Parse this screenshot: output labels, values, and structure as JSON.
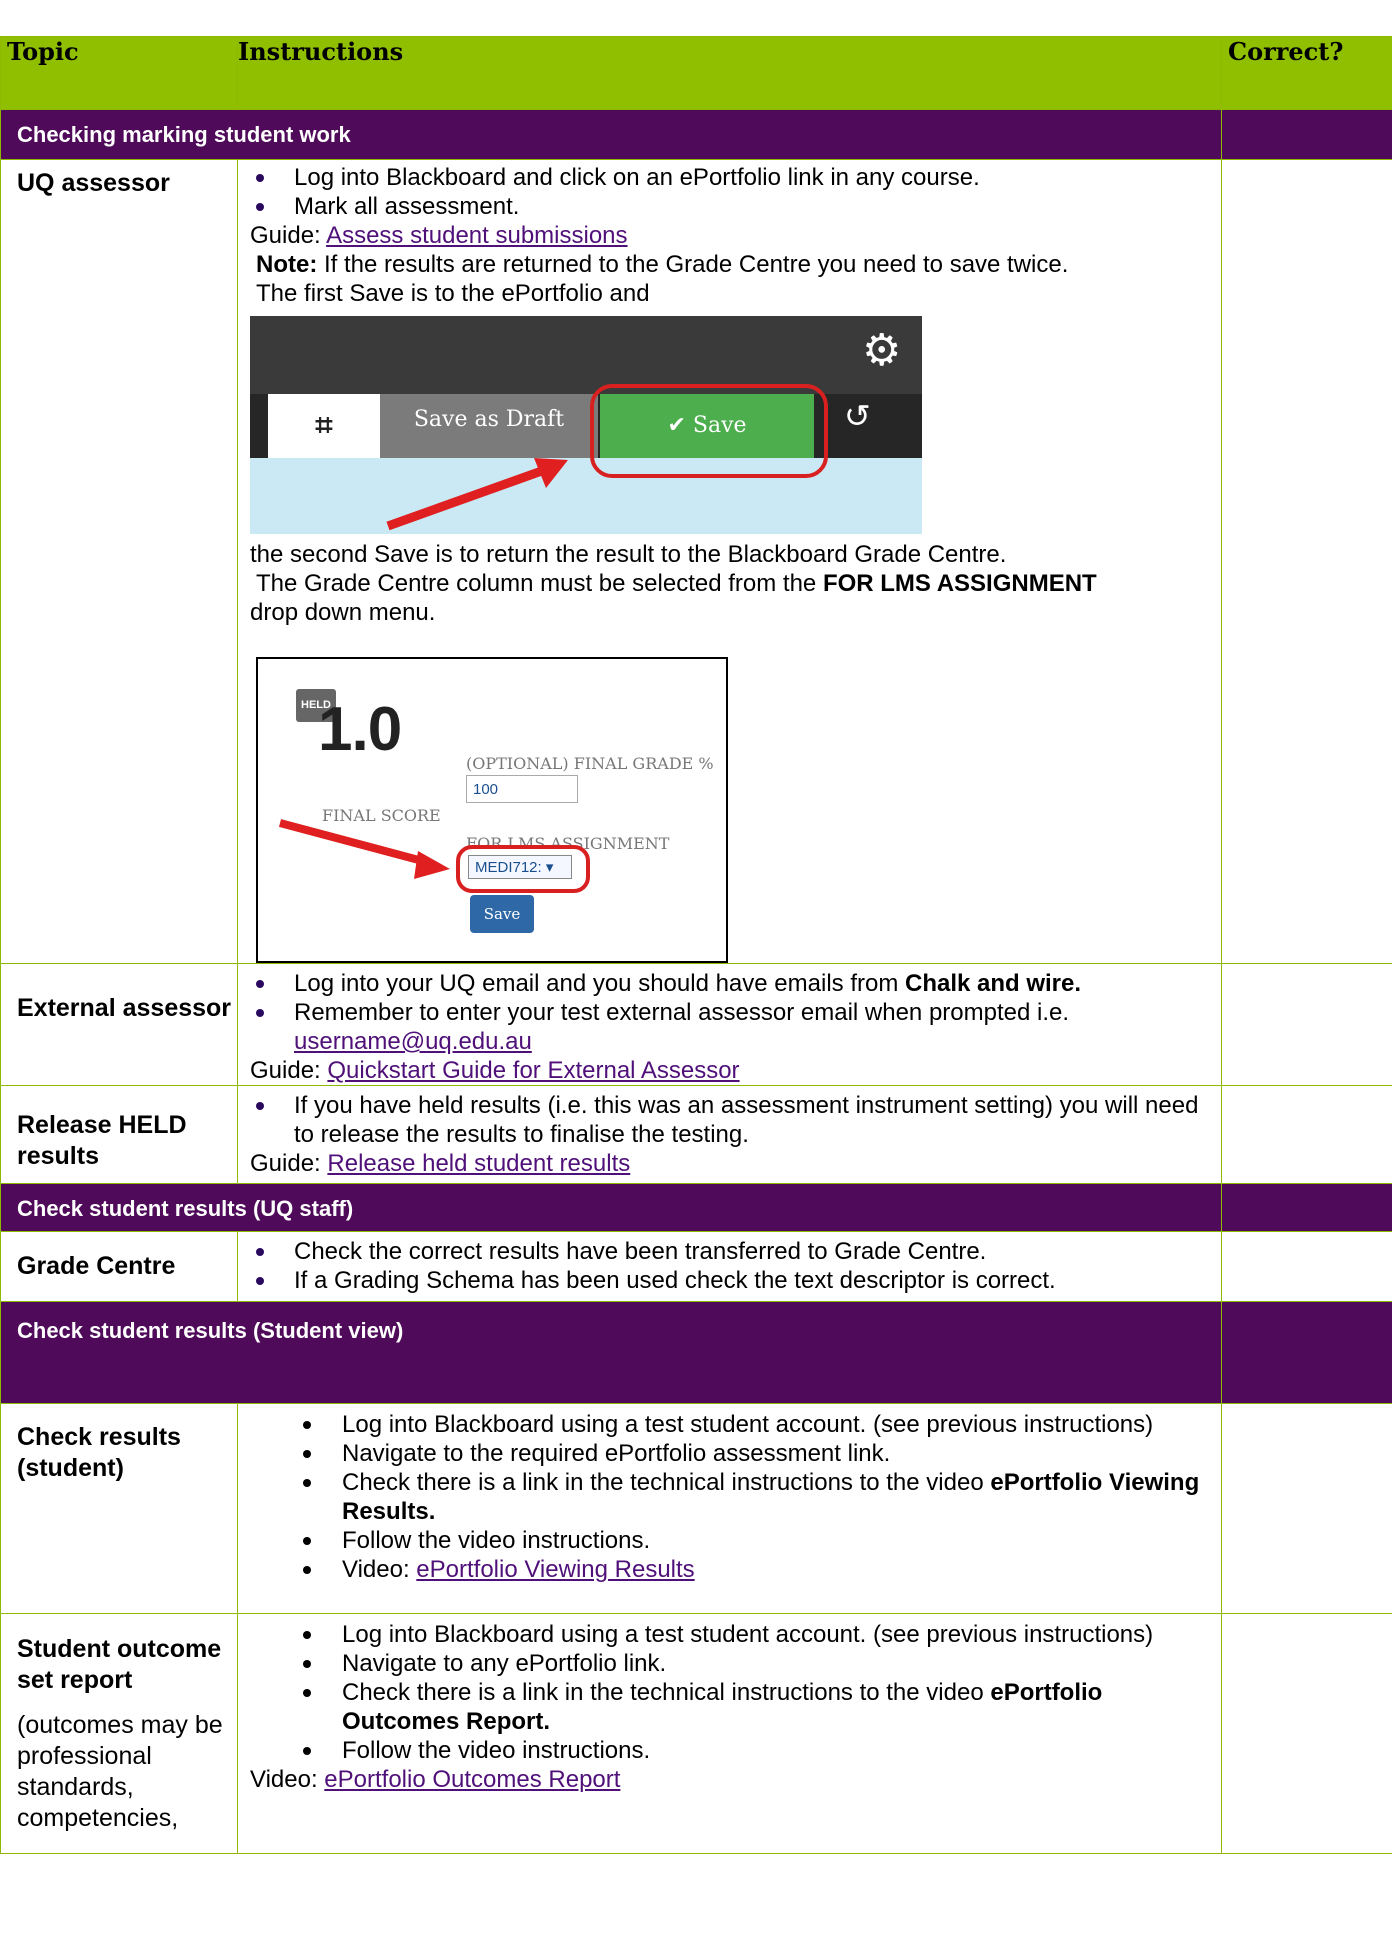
{
  "table": {
    "headers": {
      "topic": "Topic",
      "instructions": "Instructions",
      "correct": "Correct?"
    }
  },
  "sections": {
    "marking": "Checking marking student work",
    "staff": "Check student results (UQ staff)",
    "student": "Check student results (Student view)"
  },
  "rows": {
    "uq_assessor": {
      "topic": "UQ assessor",
      "bullets": [
        "Log into Blackboard and click on an ePortfolio link in any course.",
        "Mark all assessment."
      ],
      "guide_prefix": "Guide: ",
      "guide_link": "Assess student submissions",
      "note_label": "Note:",
      "note_text": " If the results are returned to the Grade Centre you need to save twice.",
      "first_save": "The first Save is to the ePortfolio and",
      "second_save": "the second Save is to return the result to the Blackboard Grade Centre.",
      "grade_col_pre": "The Grade Centre column must be selected from the ",
      "grade_col_bold": "FOR LMS ASSIGNMENT",
      "grade_col_post": "drop down menu."
    },
    "external": {
      "topic": "External assessor",
      "b1_pre": "Log into your UQ email and you should have emails from ",
      "b1_bold": "Chalk and wire.",
      "b2": "Remember to enter your test external assessor email when prompted i.e.",
      "b2_link": "username@uq.edu.au",
      "guide_prefix": "Guide: ",
      "guide_link": "Quickstart Guide for External Assessor"
    },
    "release": {
      "topic": "Release HELD results",
      "b1": "If you have held results (i.e. this was an assessment instrument setting) you will need to release the results to finalise the testing.",
      "guide_prefix": "Guide: ",
      "guide_link": "Release held student results"
    },
    "grade_centre": {
      "topic": "Grade Centre",
      "b1": "Check the correct results have been transferred to Grade Centre.",
      "b2": "If a Grading Schema has been used check the text descriptor is correct."
    },
    "check_results": {
      "topic": "Check results (student)",
      "b1": "Log into Blackboard using a test student account. (see previous instructions)",
      "b2": "Navigate to the required ePortfolio assessment link.",
      "b3_pre": "Check there is a link in the technical instructions to the video ",
      "b3_bold": "ePortfolio Viewing Results.",
      "b4": "Follow the video instructions.",
      "b5_prefix": "Video: ",
      "b5_link": "ePortfolio Viewing Results"
    },
    "outcome": {
      "topic": "Student outcome set report",
      "note": "(outcomes may be professional standards, competencies,",
      "b1": "Log into Blackboard using a test student account. (see previous instructions)",
      "b2": "Navigate to any ePortfolio link.",
      "b3_pre": "Check there is a link in the technical instructions to the video ",
      "b3_bold": "ePortfolio Outcomes Report.",
      "b4": "Follow the video instructions.",
      "video_prefix": "Video: ",
      "video_link": "ePortfolio Outcomes Report"
    }
  },
  "screenshot1": {
    "draft_label": "Save as Draft",
    "save_label": "✔ Save",
    "icons": [
      "gear-icon",
      "collapse-icon",
      "history-icon"
    ]
  },
  "screenshot2": {
    "held": "HELD",
    "score": "1.0",
    "score_label": "FINAL SCORE",
    "optional_label": "(OPTIONAL) FINAL GRADE %",
    "optional_value": "100",
    "lms_label": "FOR LMS ASSIGNMENT",
    "lms_value": "MEDI712: ▾",
    "save_label": "Save"
  },
  "colors": {
    "header_green": "#90bf00",
    "section_purple": "#4f0a5a",
    "link": "#4f1079",
    "highlight_red": "#d92020"
  }
}
